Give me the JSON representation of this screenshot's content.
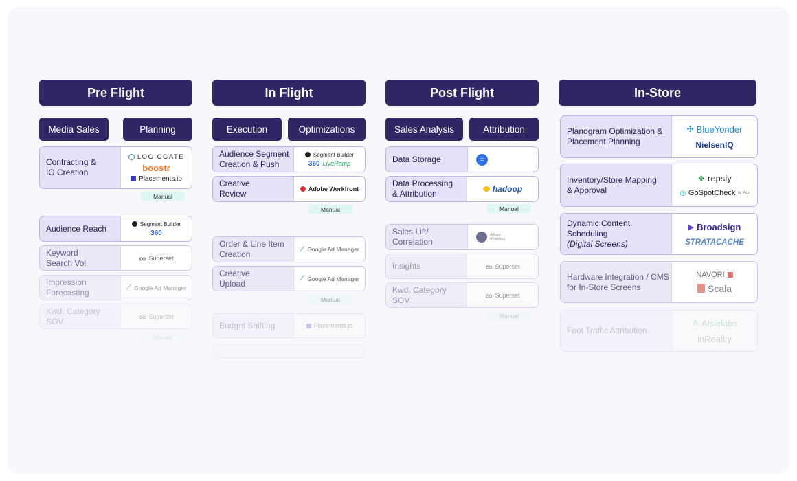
{
  "columns": {
    "pre": {
      "title": "Pre Flight",
      "pills": [
        "Media Sales",
        "Planning"
      ],
      "rows": [
        {
          "label": [
            "Contracting &",
            "IO Creation"
          ],
          "logos": [
            "LOGICGATE",
            "boostr",
            "Placements.io"
          ]
        },
        {
          "label": [
            "Audience Reach"
          ],
          "logos": [
            "Segment Builder",
            "360"
          ]
        },
        {
          "label": [
            "Keyword",
            "Search Vol"
          ],
          "logos": [
            "Superset"
          ]
        },
        {
          "label": [
            "Impression",
            "Forecasting"
          ],
          "logos": [
            "Google Ad Manager"
          ]
        },
        {
          "label": [
            "Kwd, Category",
            "SOV"
          ],
          "logos": [
            "Superset"
          ]
        }
      ],
      "manual": [
        "Manual",
        "Manual"
      ]
    },
    "in": {
      "title": "In Flight",
      "pills": [
        "Execution",
        "Optimizations"
      ],
      "rows": [
        {
          "label": [
            "Audience Segment",
            "Creation & Push"
          ],
          "logos": [
            "Segment Builder",
            "360",
            "LiveRamp"
          ]
        },
        {
          "label": [
            "Creative",
            "Review"
          ],
          "logos": [
            "Adobe Workfront"
          ]
        },
        {
          "label": [
            "Order & Line Item",
            "Creation"
          ],
          "logos": [
            "Google Ad Manager"
          ]
        },
        {
          "label": [
            "Creative",
            "Upload"
          ],
          "logos": [
            "Google Ad Manager"
          ]
        },
        {
          "label": [
            "Budget Shifting"
          ],
          "logos": [
            "Placements.io"
          ]
        }
      ],
      "manual": [
        "Manual",
        "Manual"
      ]
    },
    "post": {
      "title": "Post Flight",
      "pills": [
        "Sales Analysis",
        "Attribution"
      ],
      "rows": [
        {
          "label": [
            "Data Storage"
          ],
          "logos": []
        },
        {
          "label": [
            "Data Processing",
            "& Attribution"
          ],
          "logos": [
            "hadoop"
          ]
        },
        {
          "label": [
            "Sales Lift/",
            "Correlation"
          ],
          "logos": [
            "Adobe",
            "Analytics"
          ]
        },
        {
          "label": [
            "Insights"
          ],
          "logos": [
            "Superset"
          ]
        },
        {
          "label": [
            "Kwd, Category",
            "SOV"
          ],
          "logos": [
            "Superset"
          ]
        }
      ],
      "manual": [
        "Manual",
        "Manual"
      ]
    },
    "store": {
      "title": "In-Store",
      "rows": [
        {
          "label": [
            "Planogram Optimization &",
            "Placement Planning"
          ],
          "logos": [
            "BlueYonder",
            "NielsenIQ"
          ]
        },
        {
          "label": [
            "Inventory/Store Mapping",
            "& Approval"
          ],
          "logos": [
            "repsly",
            "GoSpotCheck",
            "by Pico"
          ]
        },
        {
          "label": [
            "Dynamic Content Scheduling",
            "(Digital Screens)"
          ],
          "logos": [
            "Broadsign",
            "STRATACACHE"
          ]
        },
        {
          "label": [
            "Hardware Integration / CMS",
            "for In-Store Screens"
          ],
          "logos": [
            "NAVORI",
            "Scala"
          ]
        },
        {
          "label": [
            "Foot Traffic Attribution"
          ],
          "logos": [
            "Aislelabs",
            "inReality"
          ]
        }
      ]
    }
  }
}
